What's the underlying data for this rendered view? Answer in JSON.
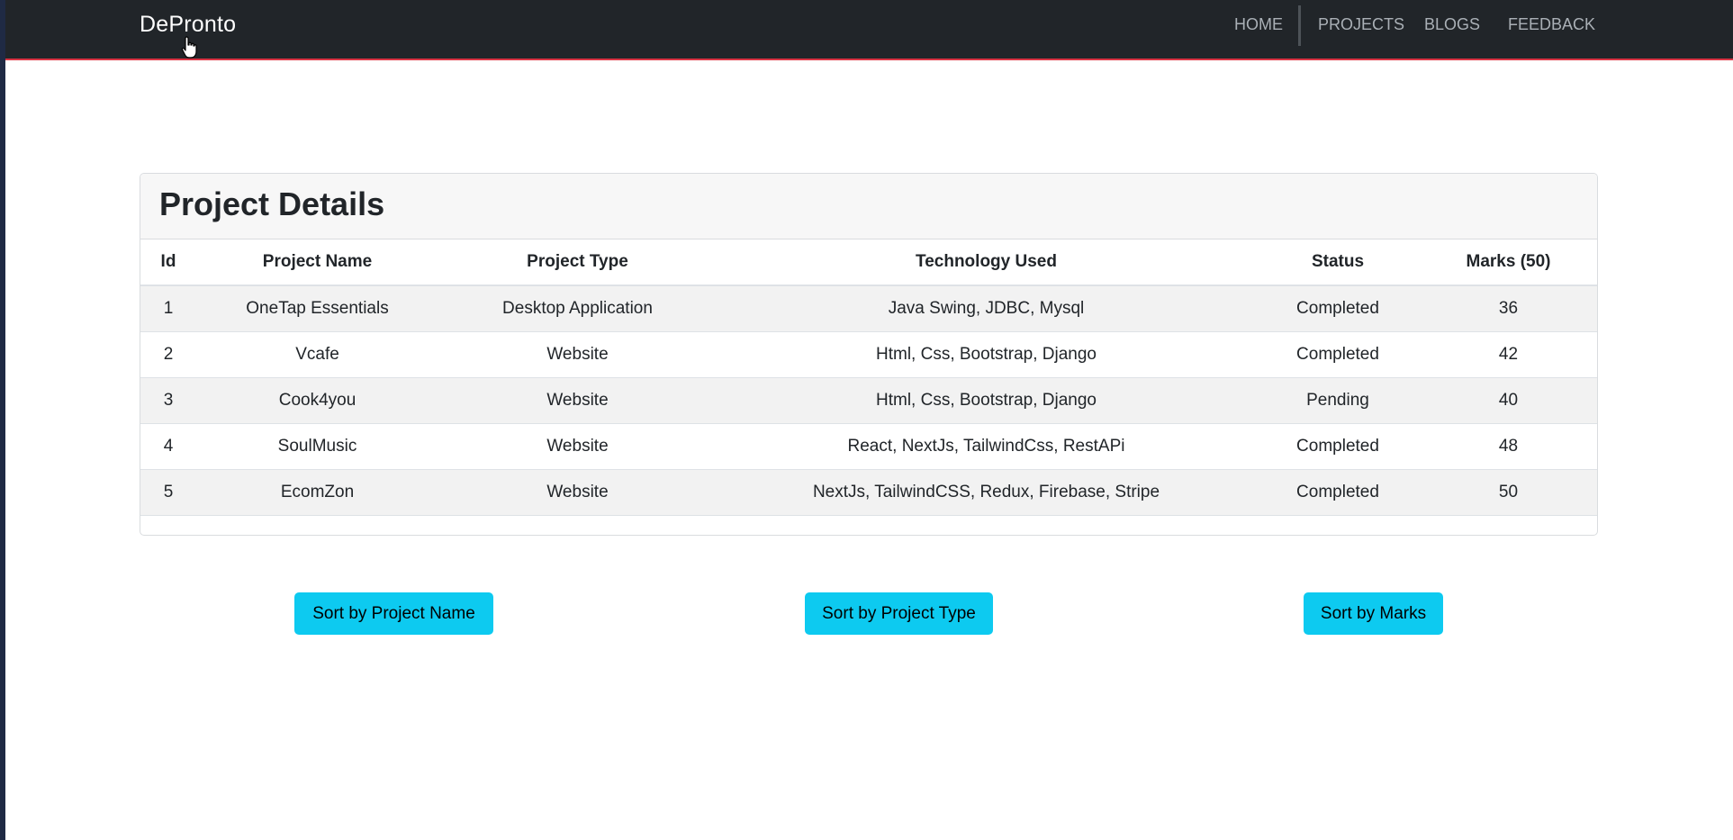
{
  "navbar": {
    "brand": "DePronto",
    "links": [
      "HOME",
      "PROJECTS",
      "BLOGS",
      "FEEDBACK"
    ]
  },
  "card": {
    "title": "Project Details",
    "columns": [
      "Id",
      "Project Name",
      "Project Type",
      "Technology Used",
      "Status",
      "Marks (50)"
    ],
    "rows": [
      [
        "1",
        "OneTap Essentials",
        "Desktop Application",
        "Java Swing, JDBC, Mysql",
        "Completed",
        "36"
      ],
      [
        "2",
        "Vcafe",
        "Website",
        "Html, Css, Bootstrap, Django",
        "Completed",
        "42"
      ],
      [
        "3",
        "Cook4you",
        "Website",
        "Html, Css, Bootstrap, Django",
        "Pending",
        "40"
      ],
      [
        "4",
        "SoulMusic",
        "Website",
        "React, NextJs, TailwindCss, RestAPi",
        "Completed",
        "48"
      ],
      [
        "5",
        "EcomZon",
        "Website",
        "NextJs, TailwindCSS, Redux, Firebase, Stripe",
        "Completed",
        "50"
      ]
    ]
  },
  "buttons": {
    "sort_name": "Sort by Project Name",
    "sort_type": "Sort by Project Type",
    "sort_marks": "Sort by Marks"
  },
  "colors": {
    "navbar_bg": "#212529",
    "navbar_accent": "#dc3545",
    "button_bg": "#0dcaf0"
  },
  "icons": {
    "cursor": "hand-pointer-icon"
  }
}
